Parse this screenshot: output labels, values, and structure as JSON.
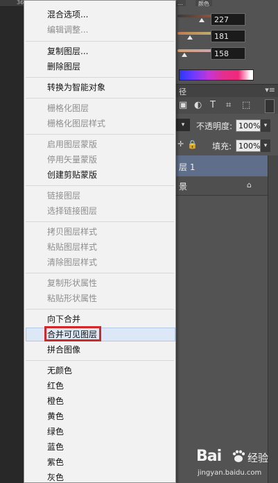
{
  "ruler": {
    "mark": "36"
  },
  "panel_tabs": {
    "tab1": "...",
    "tab2": "颜色"
  },
  "color_panel": {
    "r": "227",
    "g": "181",
    "b": "158",
    "r_level": 0.89,
    "g_level": 0.71,
    "b_level": 0.62,
    "colors": {
      "r_track": "#d4a48e",
      "g_track": "#b7a68e",
      "b_track": "#c9a79e"
    }
  },
  "layers_panel": {
    "header": "径",
    "opacity_label": "不透明度:",
    "opacity_value": "100%",
    "fill_label": "填充:",
    "fill_value": "100%",
    "selected_layer": "层 1",
    "layer2": "景"
  },
  "menu": {
    "items": [
      {
        "label": "混合选项...",
        "enabled": true
      },
      {
        "label": "编辑调整...",
        "enabled": false
      },
      {
        "label": "复制图层...",
        "enabled": true
      },
      {
        "label": "删除图层",
        "enabled": true
      },
      {
        "label": "转换为智能对象",
        "enabled": true
      },
      {
        "label": "栅格化图层",
        "enabled": false
      },
      {
        "label": "栅格化图层样式",
        "enabled": false
      },
      {
        "label": "启用图层蒙版",
        "enabled": false
      },
      {
        "label": "停用矢量蒙版",
        "enabled": false
      },
      {
        "label": "创建剪贴蒙版",
        "enabled": true
      },
      {
        "label": "链接图层",
        "enabled": false
      },
      {
        "label": "选择链接图层",
        "enabled": false
      },
      {
        "label": "拷贝图层样式",
        "enabled": false
      },
      {
        "label": "粘贴图层样式",
        "enabled": false
      },
      {
        "label": "清除图层样式",
        "enabled": false
      },
      {
        "label": "复制形状属性",
        "enabled": false
      },
      {
        "label": "粘贴形状属性",
        "enabled": false
      },
      {
        "label": "向下合并",
        "enabled": true
      },
      {
        "label": "合并可见图层",
        "enabled": true
      },
      {
        "label": "拼合图像",
        "enabled": true
      },
      {
        "label": "无颜色",
        "enabled": true
      },
      {
        "label": "红色",
        "enabled": true
      },
      {
        "label": "橙色",
        "enabled": true
      },
      {
        "label": "黄色",
        "enabled": true
      },
      {
        "label": "绿色",
        "enabled": true
      },
      {
        "label": "蓝色",
        "enabled": true
      },
      {
        "label": "紫色",
        "enabled": true
      },
      {
        "label": "灰色",
        "enabled": true
      }
    ],
    "highlighted_item": "合并可见图层"
  },
  "watermark": {
    "logo": "Bai",
    "logo2": "经验",
    "url": "jingyan.baidu.com"
  }
}
